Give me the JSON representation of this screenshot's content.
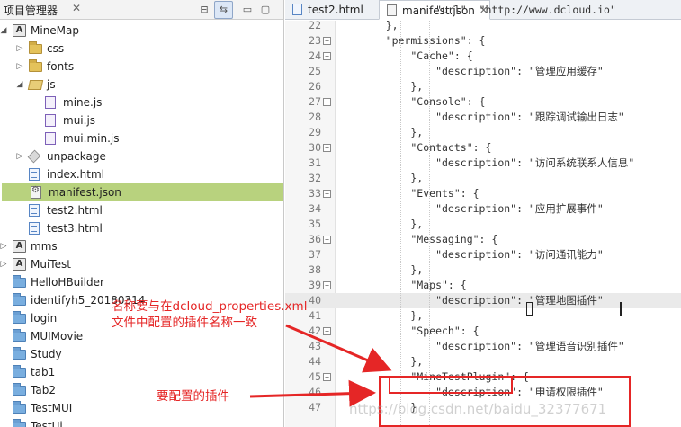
{
  "explorer": {
    "title": "项目管理器",
    "close": "✕",
    "buttons": {
      "collapse": "⊟",
      "link": "⇆",
      "minimize": "▭",
      "maximize": "▢"
    },
    "items": [
      {
        "label": "MineMap",
        "arrow": "◢",
        "icon": "project-icon",
        "text": "A"
      },
      {
        "label": "css",
        "arrow": "▷",
        "icon": "folder-icon"
      },
      {
        "label": "fonts",
        "arrow": "▷",
        "icon": "folder-icon"
      },
      {
        "label": "js",
        "arrow": "◢",
        "icon": "open-folder-icon"
      },
      {
        "label": "mine.js",
        "icon": "js-file-icon"
      },
      {
        "label": "mui.js",
        "icon": "js-file-icon"
      },
      {
        "label": "mui.min.js",
        "icon": "js-file-icon"
      },
      {
        "label": "unpackage",
        "arrow": "▷",
        "icon": "package-icon"
      },
      {
        "label": "index.html",
        "icon": "html-file-icon"
      },
      {
        "label": "manifest.json",
        "icon": "json-file-icon",
        "selected": true
      },
      {
        "label": "test2.html",
        "icon": "html-file-icon"
      },
      {
        "label": "test3.html",
        "icon": "html-file-icon"
      },
      {
        "label": "mms",
        "arrow": "▷",
        "icon": "project-icon",
        "text": "A"
      },
      {
        "label": "MuiTest",
        "arrow": "▷",
        "icon": "project-icon",
        "text": "A"
      },
      {
        "label": "HelloHBuilder",
        "icon": "blue-folder-icon"
      },
      {
        "label": "identifyh5_20180314",
        "icon": "blue-folder-icon"
      },
      {
        "label": "login",
        "icon": "blue-folder-icon"
      },
      {
        "label": "MUIMovie",
        "icon": "blue-folder-icon"
      },
      {
        "label": "Study",
        "icon": "blue-folder-icon"
      },
      {
        "label": "tab1",
        "icon": "blue-folder-icon"
      },
      {
        "label": "Tab2",
        "icon": "blue-folder-icon"
      },
      {
        "label": "TestMUI",
        "icon": "blue-folder-icon"
      },
      {
        "label": "TestUi",
        "icon": "blue-folder-icon"
      }
    ]
  },
  "editor": {
    "tabs": [
      {
        "label": "test2.html",
        "icon": "html-file-icon"
      },
      {
        "label": "manifest.json",
        "icon": "json-file-icon",
        "close": "✕",
        "active": true
      }
    ],
    "lines": [
      {
        "n": "",
        "code": "            \"url\": \"http://www.dcloud.io\""
      },
      {
        "n": "22",
        "fold": "",
        "code": "    },"
      },
      {
        "n": "23",
        "fold": "−",
        "code": "    \"permissions\": {"
      },
      {
        "n": "24",
        "fold": "−",
        "code": "        \"Cache\": {"
      },
      {
        "n": "25",
        "fold": "",
        "code": "            \"description\": \"管理应用缓存\""
      },
      {
        "n": "26",
        "fold": "",
        "code": "        },"
      },
      {
        "n": "27",
        "fold": "−",
        "code": "        \"Console\": {"
      },
      {
        "n": "28",
        "fold": "",
        "code": "            \"description\": \"跟踪调试输出日志\""
      },
      {
        "n": "29",
        "fold": "",
        "code": "        },"
      },
      {
        "n": "30",
        "fold": "−",
        "code": "        \"Contacts\": {"
      },
      {
        "n": "31",
        "fold": "",
        "code": "            \"description\": \"访问系统联系人信息\""
      },
      {
        "n": "32",
        "fold": "",
        "code": "        },"
      },
      {
        "n": "33",
        "fold": "−",
        "code": "        \"Events\": {"
      },
      {
        "n": "34",
        "fold": "",
        "code": "            \"description\": \"应用扩展事件\""
      },
      {
        "n": "35",
        "fold": "",
        "code": "        },"
      },
      {
        "n": "36",
        "fold": "−",
        "code": "        \"Messaging\": {"
      },
      {
        "n": "37",
        "fold": "",
        "code": "            \"description\": \"访问通讯能力\""
      },
      {
        "n": "38",
        "fold": "",
        "code": "        },"
      },
      {
        "n": "39",
        "fold": "−",
        "code": "        \"Maps\": {"
      },
      {
        "n": "40",
        "fold": "",
        "code": "            \"description\": \"管理地图插件\"",
        "current": true
      },
      {
        "n": "41",
        "fold": "",
        "code": "        },"
      },
      {
        "n": "42",
        "fold": "−",
        "code": "        \"Speech\": {"
      },
      {
        "n": "43",
        "fold": "",
        "code": "            \"description\": \"管理语音识别插件\""
      },
      {
        "n": "44",
        "fold": "",
        "code": "        },"
      },
      {
        "n": "45",
        "fold": "−",
        "code": "        \"MineTestPlugin\": {"
      },
      {
        "n": "46",
        "fold": "",
        "code": "            \"description\": \"申请权限插件\""
      },
      {
        "n": "47",
        "fold": "",
        "code": "        }"
      }
    ]
  },
  "annotations": {
    "note_line1": "名称要与在dcloud_properties.xml",
    "note_line2": "文件中配置的插件名称一致",
    "plugin_note": "要配置的插件",
    "watermark": "https://blog.csdn.net/baidu_32377671",
    "color": "#e52626"
  }
}
